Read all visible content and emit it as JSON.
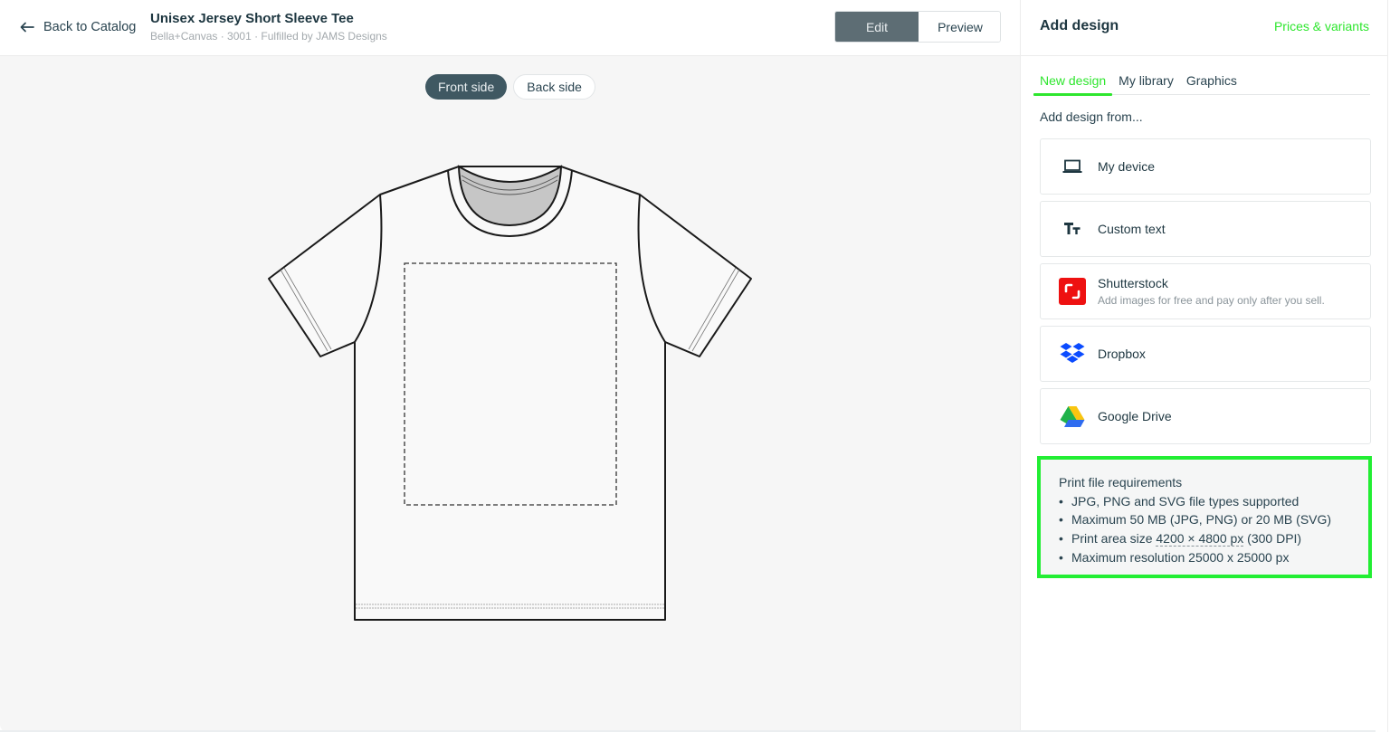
{
  "topbar": {
    "back_label": "Back to Catalog",
    "product_title": "Unisex Jersey Short Sleeve Tee",
    "product_subtitle": "Bella+Canvas · 3001 · Fulfilled by JAMS Designs",
    "mode_toggle": {
      "edit_label": "Edit",
      "preview_label": "Preview",
      "selected": "Edit"
    }
  },
  "canvas": {
    "side_toggle": {
      "front_label": "Front side",
      "back_label": "Back side",
      "selected": "Front side"
    },
    "product_image": "t-shirt-front-outline",
    "print_area": "dashed-rectangle"
  },
  "panel": {
    "title": "Add design",
    "prices_link": "Prices & variants",
    "tabs": [
      {
        "label": "New design",
        "active": true
      },
      {
        "label": "My library",
        "active": false
      },
      {
        "label": "Graphics",
        "active": false
      }
    ],
    "add_from_label": "Add design from...",
    "sources": [
      {
        "label": "My device",
        "icon": "laptop-icon"
      },
      {
        "label": "Custom text",
        "icon": "text-size-icon"
      },
      {
        "label": "Shutterstock",
        "description": "Add images for free and pay only after you sell.",
        "icon": "shutterstock-icon"
      },
      {
        "label": "Dropbox",
        "icon": "dropbox-icon"
      },
      {
        "label": "Google Drive",
        "icon": "google-drive-icon"
      }
    ],
    "requirements": {
      "title": "Print file requirements",
      "items": [
        "JPG, PNG and SVG file types supported",
        "Maximum 50 MB (JPG, PNG) or 20 MB (SVG)",
        "Maximum resolution 25000 x 25000 px"
      ],
      "print_area": {
        "prefix": "Print area size ",
        "size": "4200 × 4800 px",
        "suffix": " (300 DPI)"
      }
    }
  },
  "colors": {
    "accent_green": "#2ee62e",
    "highlight_border": "#22ee33",
    "edit_active_bg": "#5d6d74",
    "front_side_active_bg": "#3f5862",
    "shutterstock_red": "#ee1111",
    "dropbox_blue": "#0a4bff"
  }
}
